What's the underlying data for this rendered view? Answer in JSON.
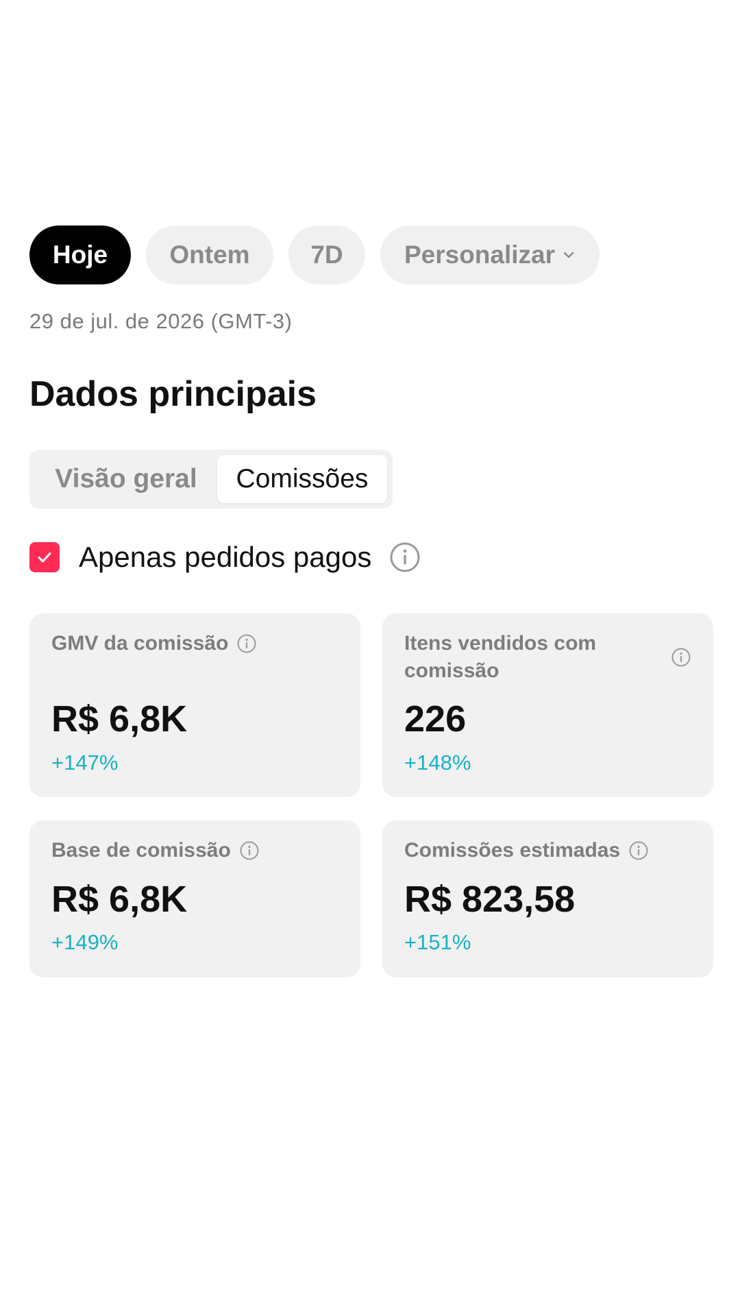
{
  "date_filters": {
    "chips": [
      {
        "label": "Hoje",
        "active": true
      },
      {
        "label": "Ontem",
        "active": false
      },
      {
        "label": "7D",
        "active": false
      },
      {
        "label": "Personalizar",
        "active": false,
        "icon": "chevron-down-icon"
      }
    ],
    "date_text": "29 de jul. de 2026 (GMT-3)"
  },
  "section": {
    "title": "Dados principais"
  },
  "tabs": [
    {
      "label": "Visão geral",
      "selected": false
    },
    {
      "label": "Comissões",
      "selected": true
    }
  ],
  "filter": {
    "paid_only_label": "Apenas pedidos pagos",
    "paid_only_checked": true,
    "info_icon": "info-icon"
  },
  "metrics": [
    {
      "label": "GMV da comissão",
      "value": "R$ 6,8K",
      "change": "+147%"
    },
    {
      "label": "Itens vendidos com comissão",
      "value": "226",
      "change": "+148%"
    },
    {
      "label": "Base de comissão",
      "value": "R$ 6,8K",
      "change": "+149%"
    },
    {
      "label": "Comissões estimadas",
      "value": "R$ 823,58",
      "change": "+151%"
    }
  ],
  "colors": {
    "accent_checkbox": "#fe2c55",
    "positive_change": "#19b3c4",
    "active_chip_bg": "#000000",
    "card_bg": "#f1f1f1"
  }
}
